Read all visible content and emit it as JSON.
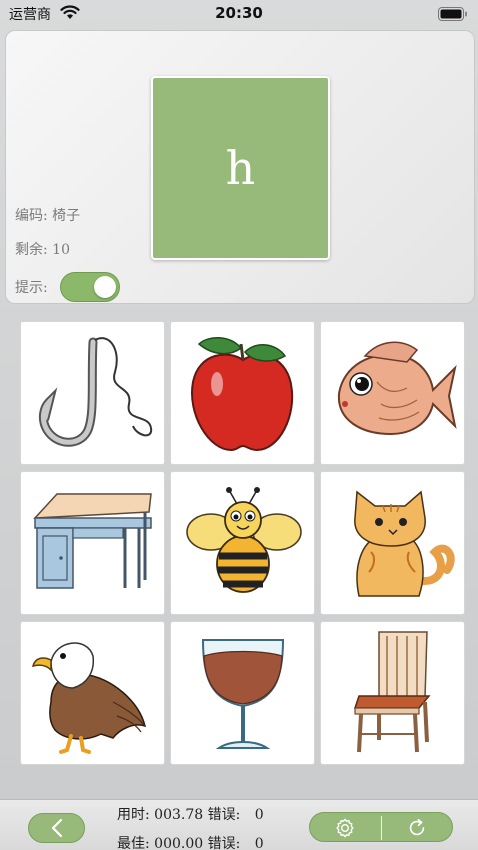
{
  "status_bar": {
    "carrier": "运营商",
    "time": "20:30",
    "icons": [
      "wifi-icon",
      "battery-icon"
    ]
  },
  "top_panel": {
    "letter": "h",
    "code_label": "编码: 椅子",
    "remaining_label": "剩余: 10",
    "hint_label": "提示:",
    "hint_enabled": true
  },
  "grid": {
    "tiles": [
      {
        "name": "hook"
      },
      {
        "name": "apple"
      },
      {
        "name": "fish"
      },
      {
        "name": "desk"
      },
      {
        "name": "bee"
      },
      {
        "name": "cat"
      },
      {
        "name": "eagle"
      },
      {
        "name": "wine-glass"
      },
      {
        "name": "chair"
      }
    ]
  },
  "bottom_bar": {
    "time_label": "用时:",
    "time_value": "003.78",
    "error_label": "错误:",
    "error_value": "0",
    "best_label": "最佳:",
    "best_value": "000.00",
    "best_error_label": "错误:",
    "best_error_value": "0",
    "icons": [
      "back-chevron-icon",
      "gear-icon",
      "reload-icon"
    ]
  },
  "colors": {
    "accent_green": "#97b97a",
    "card_border": "#ffffff"
  }
}
